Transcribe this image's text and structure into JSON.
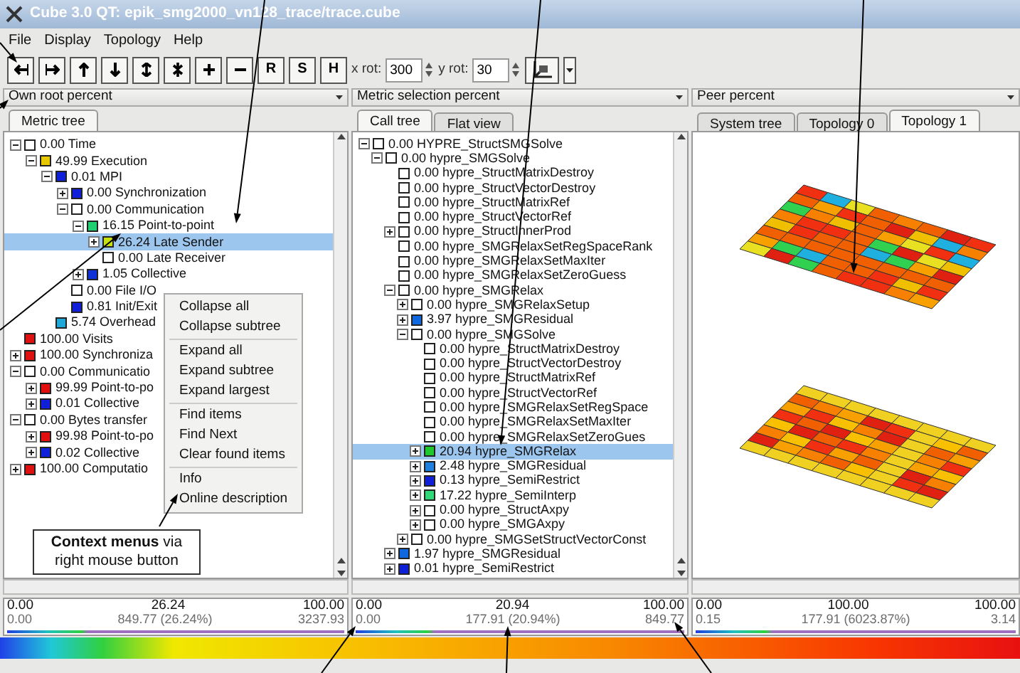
{
  "window": {
    "title": "Cube 3.0 QT: epik_smg2000_vn128_trace/trace.cube"
  },
  "menu": [
    "File",
    "Display",
    "Topology",
    "Help"
  ],
  "toolbar": {
    "letter_buttons": [
      "R",
      "S",
      "H"
    ],
    "x_rot": {
      "label": "x rot:",
      "value": "300"
    },
    "y_rot": {
      "label": "y rot:",
      "value": "30"
    }
  },
  "metric_panel": {
    "combo": "Own root percent",
    "tabs": [
      {
        "label": "Metric tree",
        "selected": true
      }
    ],
    "tree": [
      {
        "text": "0.00 Time",
        "color": "#ffffff",
        "selected": false,
        "expanded": true,
        "children": [
          {
            "text": "49.99 Execution",
            "color": "#e8c800",
            "selected": false,
            "expanded": true,
            "children": [
              {
                "text": "0.01 MPI",
                "color": "#1020d8",
                "selected": false,
                "expanded": true,
                "children": [
                  {
                    "text": "0.00 Synchronization",
                    "color": "#1020d8",
                    "selected": false,
                    "expanded": false
                  },
                  {
                    "text": "0.00 Communication",
                    "color": "#ffffff",
                    "selected": false,
                    "expanded": true,
                    "children": [
                      {
                        "text": "16.15 Point-to-point",
                        "color": "#20d070",
                        "selected": false,
                        "expanded": true,
                        "children": [
                          {
                            "text": "26.24 Late Sender",
                            "color": "#c8e010",
                            "selected": true,
                            "expanded": false
                          },
                          {
                            "text": "0.00 Late Receiver",
                            "color": "#ffffff",
                            "selected": false
                          }
                        ]
                      },
                      {
                        "text": "1.05 Collective",
                        "color": "#1030d8",
                        "selected": false,
                        "expanded": false
                      }
                    ]
                  },
                  {
                    "text": "0.00 File I/O",
                    "color": "#ffffff",
                    "selected": false
                  },
                  {
                    "text": "0.81 Init/Exit",
                    "color": "#1020d8",
                    "selected": false
                  }
                ]
              },
              {
                "text": "5.74 Overhead",
                "color": "#20a8d8",
                "selected": false
              }
            ]
          }
        ]
      },
      {
        "text": "100.00 Visits",
        "color": "#e01010",
        "selected": false
      },
      {
        "text": "100.00 Synchroniza",
        "color": "#e01010",
        "selected": false,
        "expanded": false
      },
      {
        "text": "0.00 Communicatio",
        "color": "#ffffff",
        "selected": false,
        "expanded": true,
        "children": [
          {
            "text": "99.99 Point-to-po",
            "color": "#e01010",
            "selected": false,
            "expanded": false
          },
          {
            "text": "0.01 Collective",
            "color": "#1020d8",
            "selected": false,
            "expanded": false
          }
        ]
      },
      {
        "text": "0.00 Bytes transfer",
        "color": "#ffffff",
        "selected": false,
        "expanded": true,
        "children": [
          {
            "text": "99.98 Point-to-po",
            "color": "#e01010",
            "selected": false,
            "expanded": false
          },
          {
            "text": "0.02 Collective",
            "color": "#1020d8",
            "selected": false,
            "expanded": false
          }
        ]
      },
      {
        "text": "100.00 Computatio",
        "color": "#e01010",
        "selected": false,
        "expanded": false
      }
    ],
    "context_menu": [
      [
        "Collapse all",
        "Collapse subtree"
      ],
      [
        "Expand all",
        "Expand subtree",
        "Expand largest"
      ],
      [
        "Find items",
        "Find Next",
        "Clear found items"
      ],
      [
        "Info",
        "Online description"
      ]
    ],
    "callout": "**Context menus** via right mouse button",
    "value_bar": {
      "min": "0.00",
      "current": "26.24",
      "max": "100.00",
      "abs_min": "0.00",
      "abs_current": "849.77 (26.24%)",
      "abs_max": "3237.93"
    }
  },
  "call_panel": {
    "combo": "Metric selection percent",
    "tabs": [
      {
        "label": "Call tree",
        "selected": true
      },
      {
        "label": "Flat view",
        "selected": false
      }
    ],
    "tree": [
      {
        "text": "0.00 HYPRE_StructSMGSolve",
        "color": "#ffffff",
        "selected": false,
        "expanded": true,
        "children": [
          {
            "text": "0.00 hypre_SMGSolve",
            "color": "#ffffff",
            "selected": false,
            "expanded": true,
            "children": [
              {
                "text": "0.00 hypre_StructMatrixDestroy",
                "color": "#ffffff",
                "selected": false
              },
              {
                "text": "0.00 hypre_StructVectorDestroy",
                "color": "#ffffff",
                "selected": false
              },
              {
                "text": "0.00 hypre_StructMatrixRef",
                "color": "#ffffff",
                "selected": false
              },
              {
                "text": "0.00 hypre_StructVectorRef",
                "color": "#ffffff",
                "selected": false
              },
              {
                "text": "0.00 hypre_StructInnerProd",
                "color": "#ffffff",
                "selected": false,
                "expanded": false
              },
              {
                "text": "0.00 hypre_SMGRelaxSetRegSpaceRank",
                "color": "#ffffff",
                "selected": false
              },
              {
                "text": "0.00 hypre_SMGRelaxSetMaxIter",
                "color": "#ffffff",
                "selected": false
              },
              {
                "text": "0.00 hypre_SMGRelaxSetZeroGuess",
                "color": "#ffffff",
                "selected": false
              },
              {
                "text": "0.00 hypre_SMGRelax",
                "color": "#ffffff",
                "selected": false,
                "expanded": true,
                "children": [
                  {
                    "text": "0.00 hypre_SMGRelaxSetup",
                    "color": "#ffffff",
                    "selected": false,
                    "expanded": false
                  },
                  {
                    "text": "3.97 hypre_SMGResidual",
                    "color": "#1068e0",
                    "selected": false,
                    "expanded": false
                  },
                  {
                    "text": "0.00 hypre_SMGSolve",
                    "color": "#ffffff",
                    "selected": false,
                    "expanded": true,
                    "children": [
                      {
                        "text": "0.00 hypre_StructMatrixDestroy",
                        "color": "#ffffff",
                        "selected": false
                      },
                      {
                        "text": "0.00 hypre_StructVectorDestroy",
                        "color": "#ffffff",
                        "selected": false
                      },
                      {
                        "text": "0.00 hypre_StructMatrixRef",
                        "color": "#ffffff",
                        "selected": false
                      },
                      {
                        "text": "0.00 hypre_StructVectorRef",
                        "color": "#ffffff",
                        "selected": false
                      },
                      {
                        "text": "0.00 hypre_SMGRelaxSetRegSpace",
                        "color": "#ffffff",
                        "selected": false
                      },
                      {
                        "text": "0.00 hypre_SMGRelaxSetMaxIter",
                        "color": "#ffffff",
                        "selected": false
                      },
                      {
                        "text": "0.00 hypre_SMGRelaxSetZeroGues",
                        "color": "#ffffff",
                        "selected": false
                      },
                      {
                        "text": "20.94 hypre_SMGRelax",
                        "color": "#20c830",
                        "selected": true,
                        "expanded": false
                      },
                      {
                        "text": "2.48 hypre_SMGResidual",
                        "color": "#2080e0",
                        "selected": false,
                        "expanded": false
                      },
                      {
                        "text": "0.13 hypre_SemiRestrict",
                        "color": "#1020d8",
                        "selected": false,
                        "expanded": false
                      },
                      {
                        "text": "17.22 hypre_SemiInterp",
                        "color": "#30d878",
                        "selected": false,
                        "expanded": false
                      },
                      {
                        "text": "0.00 hypre_StructAxpy",
                        "color": "#ffffff",
                        "selected": false,
                        "expanded": false
                      },
                      {
                        "text": "0.00 hypre_SMGAxpy",
                        "color": "#ffffff",
                        "selected": false,
                        "expanded": false
                      }
                    ]
                  },
                  {
                    "text": "0.00 hypre_SMGSetStructVectorConst",
                    "color": "#ffffff",
                    "selected": false,
                    "expanded": false
                  }
                ]
              },
              {
                "text": "1.97 hypre_SMGResidual",
                "color": "#1068e0",
                "selected": false,
                "expanded": false
              },
              {
                "text": "0.01 hypre_SemiRestrict",
                "color": "#1020d8",
                "selected": false,
                "expanded": false
              }
            ]
          }
        ]
      }
    ],
    "value_bar": {
      "min": "0.00",
      "current": "20.94",
      "max": "100.00",
      "abs_min": "0.00",
      "abs_current": "177.91 (20.94%)",
      "abs_max": "849.77"
    }
  },
  "system_panel": {
    "combo": "Peer percent",
    "tabs": [
      {
        "label": "System tree",
        "selected": false
      },
      {
        "label": "Topology 0",
        "selected": false
      },
      {
        "label": "Topology 1",
        "selected": true
      }
    ],
    "value_bar": {
      "min": "0.00",
      "current": "100.00",
      "max": "100.00",
      "abs_min": "0.15",
      "abs_current": "177.91 (6023.87%)",
      "abs_max": "3.14"
    }
  }
}
